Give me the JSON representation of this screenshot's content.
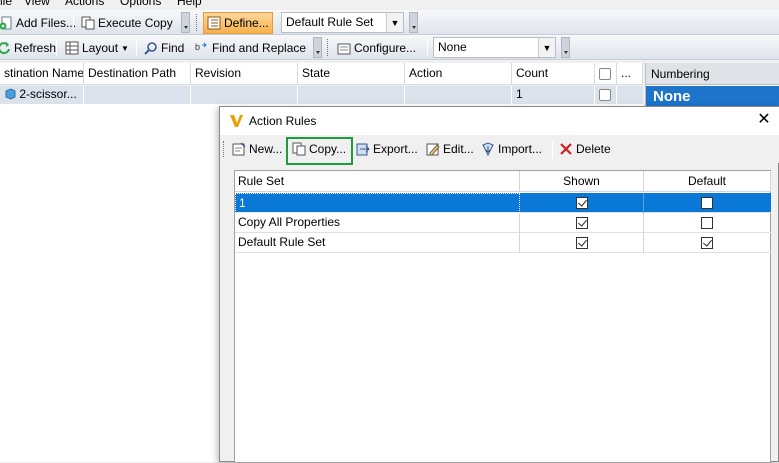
{
  "menu": [
    "ile",
    "View",
    "Actions",
    "Options",
    "Help"
  ],
  "toolbar1": {
    "add_files": "Add Files...",
    "execute_copy": "Execute Copy",
    "define": "Define...",
    "rule_set_value": "Default Rule Set"
  },
  "toolbar2": {
    "refresh": "Refresh",
    "layout": "Layout",
    "find": "Find",
    "find_replace": "Find and Replace",
    "configure": "Configure...",
    "scheme_value": "None"
  },
  "grid": {
    "columns": [
      "stination Name",
      "Destination Path",
      "Revision",
      "State",
      "Action",
      "Count",
      "..."
    ],
    "row": {
      "name": "2-scissor...",
      "count": "1"
    }
  },
  "numbering": {
    "header": "Numbering",
    "value": "None"
  },
  "dialog": {
    "title": "Action Rules",
    "toolbar": {
      "new": "New...",
      "copy": "Copy...",
      "export": "Export...",
      "edit": "Edit...",
      "import": "Import...",
      "delete": "Delete"
    },
    "table": {
      "headers": [
        "Rule Set",
        "Shown",
        "Default"
      ],
      "rows": [
        {
          "name": "1",
          "shown": true,
          "default": false,
          "selected": true
        },
        {
          "name": "Copy All Properties",
          "shown": true,
          "default": false,
          "selected": false
        },
        {
          "name": "Default Rule Set",
          "shown": true,
          "default": true,
          "selected": false
        }
      ]
    }
  },
  "colors": {
    "selection": "#0a78d7",
    "highlight_border": "#1e9e3a",
    "numbering_none": "#1e74c9"
  }
}
